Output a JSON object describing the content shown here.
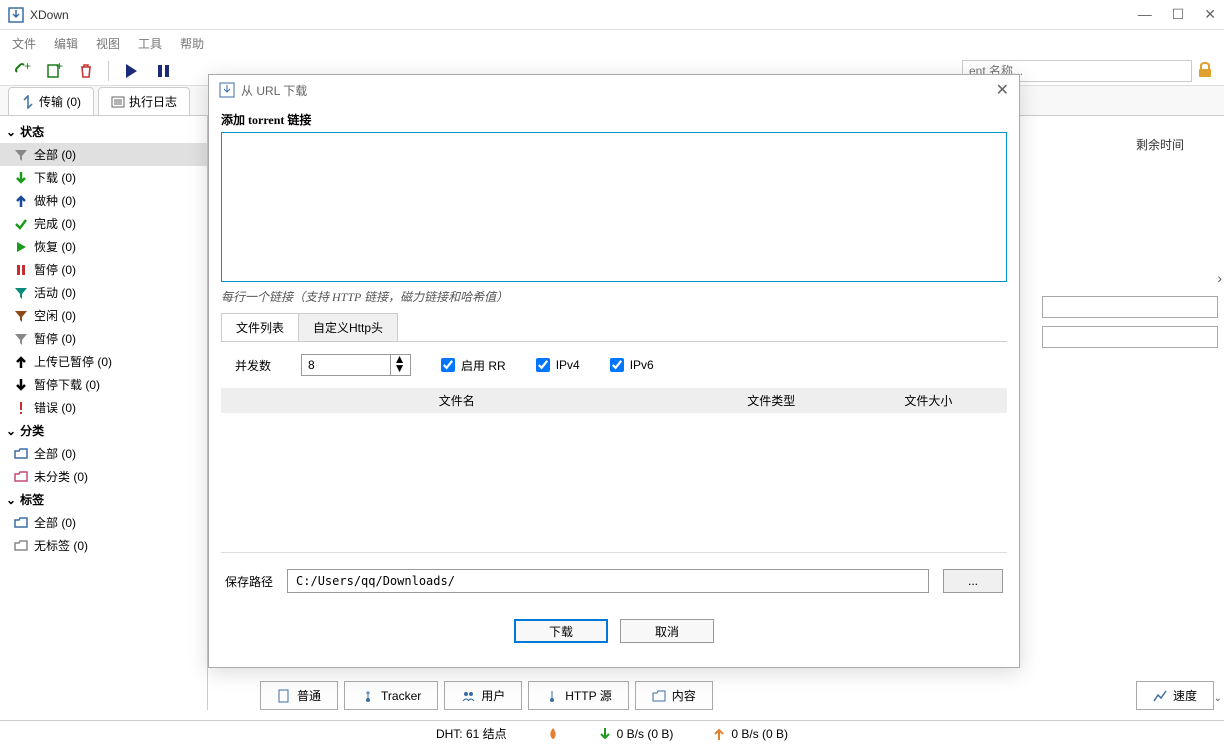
{
  "app": {
    "title": "XDown"
  },
  "menubar": [
    "文件",
    "编辑",
    "视图",
    "工具",
    "帮助"
  ],
  "toolbar": {
    "search_placeholder": "ent 名称..."
  },
  "tabs": [
    {
      "label": "传输 (0)"
    },
    {
      "label": "执行日志"
    }
  ],
  "sidebar": {
    "groups": [
      {
        "header": "状态",
        "items": [
          {
            "icon": "filter-gray",
            "label": "全部 (0)",
            "selected": true
          },
          {
            "icon": "arrow-down-green",
            "label": "下载 (0)"
          },
          {
            "icon": "arrow-up-blue",
            "label": "做种 (0)"
          },
          {
            "icon": "check-green",
            "label": "完成 (0)"
          },
          {
            "icon": "play-green",
            "label": "恢复 (0)"
          },
          {
            "icon": "pause-red",
            "label": "暂停 (0)"
          },
          {
            "icon": "filter-teal",
            "label": "活动 (0)"
          },
          {
            "icon": "filter-brown",
            "label": "空闲 (0)"
          },
          {
            "icon": "filter-gray",
            "label": "暂停 (0)"
          },
          {
            "icon": "arrow-up-black",
            "label": "上传已暂停 (0)"
          },
          {
            "icon": "arrow-down-black",
            "label": "暂停下载 (0)"
          },
          {
            "icon": "exclaim-red",
            "label": "错误 (0)"
          }
        ]
      },
      {
        "header": "分类",
        "items": [
          {
            "icon": "folder-blue",
            "label": "全部 (0)"
          },
          {
            "icon": "folder-pink",
            "label": "未分类 (0)"
          }
        ]
      },
      {
        "header": "标签",
        "items": [
          {
            "icon": "folder-blue",
            "label": "全部 (0)"
          },
          {
            "icon": "folder-gray",
            "label": "无标签 (0)"
          }
        ]
      }
    ]
  },
  "content": {
    "column_header": "剩余时间"
  },
  "bottom_tabs": [
    "普通",
    "Tracker",
    "用户",
    "HTTP 源",
    "内容"
  ],
  "speed_label": "速度",
  "statusbar": {
    "dht": "DHT: 61 结点",
    "disk": "",
    "down": "0 B/s (0 B)",
    "up": "0 B/s (0 B)"
  },
  "dialog": {
    "title": "从 URL 下载",
    "add_label": "添加 torrent 链接",
    "hint": "每行一个链接（支持 HTTP 链接，磁力链接和哈希值）",
    "tabs": [
      "文件列表",
      "自定义Http头"
    ],
    "concurrency_label": "并发数",
    "concurrency_value": "8",
    "enable_rr": "启用 RR",
    "ipv4": "IPv4",
    "ipv6": "IPv6",
    "file_headers": [
      "文件名",
      "文件类型",
      "文件大小"
    ],
    "save_label": "保存路径",
    "save_path": "C:/Users/qq/Downloads/",
    "browse": "...",
    "download": "下载",
    "cancel": "取消"
  }
}
